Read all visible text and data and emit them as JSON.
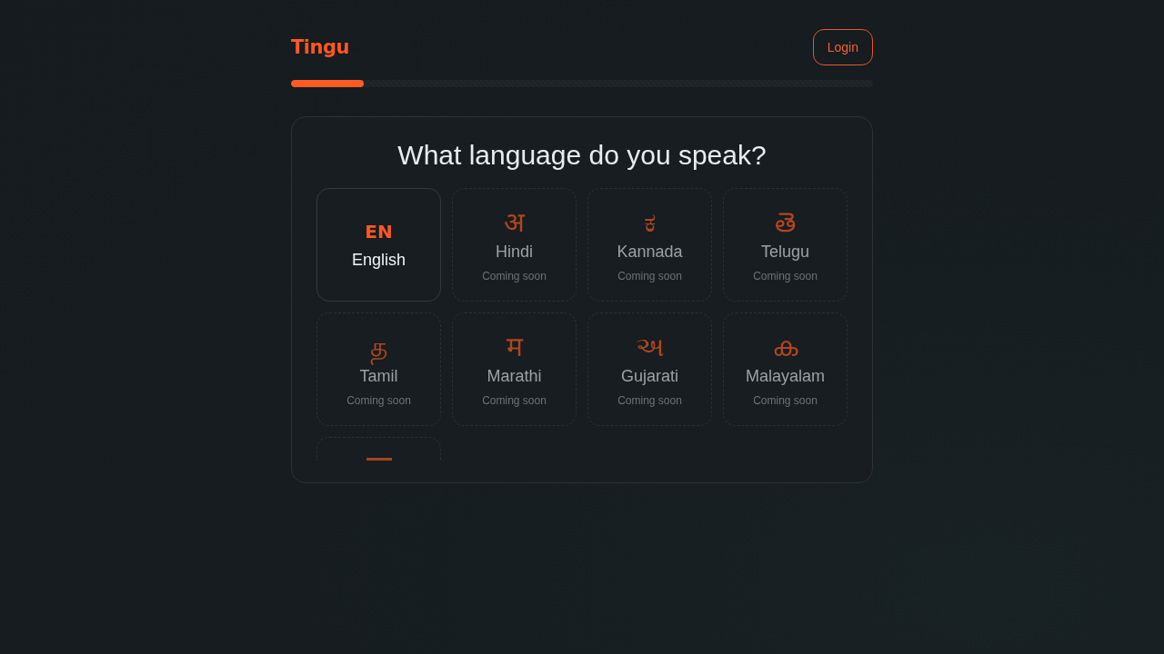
{
  "header": {
    "logo": "Tingu",
    "login_button": "Login"
  },
  "progress": {
    "level": 0.125
  },
  "question": {
    "title": "What language do you speak?"
  },
  "languages": [
    {
      "kind": "code",
      "symbol": "EN",
      "name": "English",
      "disabled": false
    },
    {
      "kind": "script",
      "symbol": "अ",
      "name": "Hindi",
      "note": "Coming soon",
      "disabled": true
    },
    {
      "kind": "script",
      "symbol": "ಕ",
      "name": "Kannada",
      "note": "Coming soon",
      "disabled": true
    },
    {
      "kind": "script",
      "symbol": "తె",
      "name": "Telugu",
      "note": "Coming soon",
      "disabled": true
    },
    {
      "kind": "script",
      "symbol": "த",
      "name": "Tamil",
      "note": "Coming soon",
      "disabled": true
    },
    {
      "kind": "script",
      "symbol": "म",
      "name": "Marathi",
      "note": "Coming soon",
      "disabled": true
    },
    {
      "kind": "script",
      "symbol": "અ",
      "name": "Gujarati",
      "note": "Coming soon",
      "disabled": true
    },
    {
      "kind": "script",
      "symbol": "ക",
      "name": "Malayalam",
      "note": "Coming soon",
      "disabled": true
    }
  ],
  "cut_off_card_below": true
}
